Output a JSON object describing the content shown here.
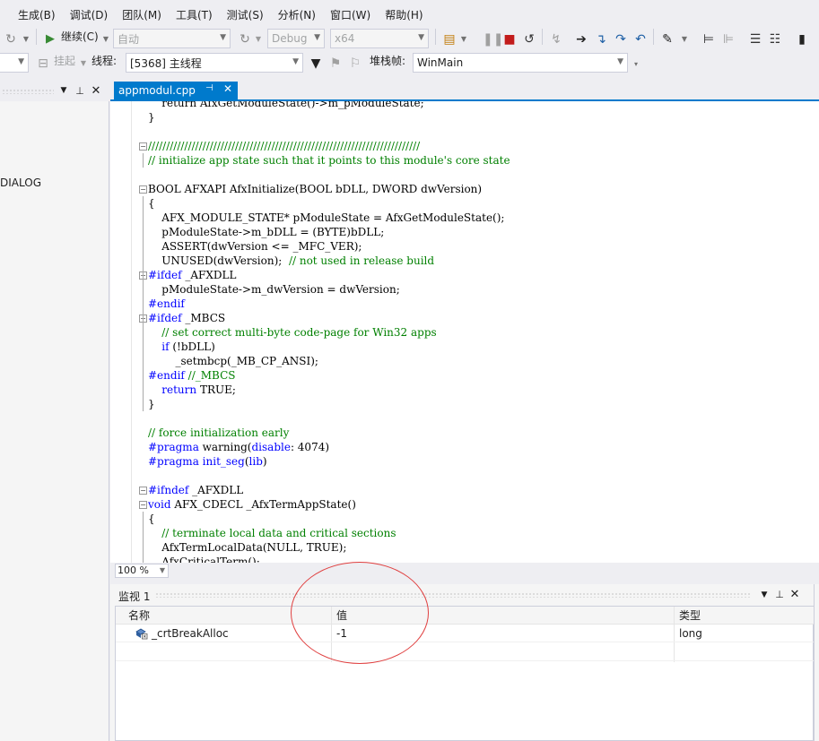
{
  "menu": [
    "生成(B)",
    "调试(D)",
    "团队(M)",
    "工具(T)",
    "测试(S)",
    "分析(N)",
    "窗口(W)",
    "帮助(H)"
  ],
  "toolbar": {
    "continue_label": "继续(C)",
    "config_value": "自动",
    "build_config": "Debug",
    "platform": "x64"
  },
  "debug_location": {
    "suspend_label": "挂起",
    "thread_label": "线程:",
    "thread_value": "[5368] 主线程",
    "stack_label": "堆栈帧:",
    "stack_value": "WinMain"
  },
  "left_panel": {
    "truncated_item": "DIALOG"
  },
  "editor_tab": {
    "filename": "appmodul.cpp"
  },
  "code_lines": [
    {
      "segments": [
        {
          "t": "    ",
          "c": ""
        },
        {
          "t": "return AfxGetModuleState()->m_pModuleState;",
          "c": ""
        }
      ]
    },
    {
      "segments": [
        {
          "t": "}",
          "c": ""
        }
      ]
    },
    {
      "segments": [
        {
          "t": "",
          "c": ""
        }
      ]
    },
    {
      "segments": [
        {
          "t": "///////////////////////////////////////////////////////////////////////////",
          "c": "cm"
        }
      ]
    },
    {
      "segments": [
        {
          "t": "// initialize app state such that it points to this module's core state",
          "c": "cm"
        }
      ]
    },
    {
      "segments": [
        {
          "t": "",
          "c": ""
        }
      ]
    },
    {
      "segments": [
        {
          "t": "BOOL AFXAPI AfxInitialize(BOOL bDLL, DWORD dwVersion)",
          "c": ""
        }
      ]
    },
    {
      "segments": [
        {
          "t": "{",
          "c": ""
        }
      ]
    },
    {
      "segments": [
        {
          "t": "    AFX_MODULE_STATE* pModuleState = AfxGetModuleState();",
          "c": ""
        }
      ]
    },
    {
      "segments": [
        {
          "t": "    pModuleState->m_bDLL = (BYTE)bDLL;",
          "c": ""
        }
      ]
    },
    {
      "segments": [
        {
          "t": "    ASSERT(dwVersion <= _MFC_VER);",
          "c": ""
        }
      ]
    },
    {
      "segments": [
        {
          "t": "    UNUSED(dwVersion);  ",
          "c": ""
        },
        {
          "t": "// not used in release build",
          "c": "cm"
        }
      ]
    },
    {
      "segments": [
        {
          "t": "#ifdef",
          "c": "pp"
        },
        {
          "t": " _AFXDLL",
          "c": ""
        }
      ]
    },
    {
      "segments": [
        {
          "t": "    pModuleState->m_dwVersion = dwVersion;",
          "c": ""
        }
      ]
    },
    {
      "segments": [
        {
          "t": "#endif",
          "c": "pp"
        }
      ]
    },
    {
      "segments": [
        {
          "t": "#ifdef",
          "c": "pp"
        },
        {
          "t": " _MBCS",
          "c": ""
        }
      ]
    },
    {
      "segments": [
        {
          "t": "    // set correct multi-byte code-page for Win32 apps",
          "c": "cm"
        }
      ]
    },
    {
      "segments": [
        {
          "t": "    ",
          "c": ""
        },
        {
          "t": "if",
          "c": "kw"
        },
        {
          "t": " (!bDLL)",
          "c": ""
        }
      ]
    },
    {
      "segments": [
        {
          "t": "        _setmbcp(_MB_CP_ANSI);",
          "c": ""
        }
      ]
    },
    {
      "segments": [
        {
          "t": "#endif",
          "c": "pp"
        },
        {
          "t": " //_MBCS",
          "c": "cm"
        }
      ]
    },
    {
      "segments": [
        {
          "t": "    ",
          "c": ""
        },
        {
          "t": "return",
          "c": "kw"
        },
        {
          "t": " TRUE;",
          "c": ""
        }
      ]
    },
    {
      "segments": [
        {
          "t": "}",
          "c": ""
        }
      ]
    },
    {
      "segments": [
        {
          "t": "",
          "c": ""
        }
      ]
    },
    {
      "segments": [
        {
          "t": "// force initialization early",
          "c": "cm"
        }
      ]
    },
    {
      "segments": [
        {
          "t": "#pragma",
          "c": "pp"
        },
        {
          "t": " warning(",
          "c": ""
        },
        {
          "t": "disable",
          "c": "kw"
        },
        {
          "t": ": 4074)",
          "c": ""
        }
      ]
    },
    {
      "segments": [
        {
          "t": "#pragma",
          "c": "pp"
        },
        {
          "t": " ",
          "c": ""
        },
        {
          "t": "init_seg",
          "c": "kw"
        },
        {
          "t": "(",
          "c": ""
        },
        {
          "t": "lib",
          "c": "kw"
        },
        {
          "t": ")",
          "c": ""
        }
      ]
    },
    {
      "segments": [
        {
          "t": "",
          "c": ""
        }
      ]
    },
    {
      "segments": [
        {
          "t": "#ifndef",
          "c": "pp"
        },
        {
          "t": " _AFXDLL",
          "c": ""
        }
      ]
    },
    {
      "segments": [
        {
          "t": "void",
          "c": "kw"
        },
        {
          "t": " AFX_CDECL _AfxTermAppState()",
          "c": ""
        }
      ]
    },
    {
      "segments": [
        {
          "t": "{",
          "c": ""
        }
      ]
    },
    {
      "segments": [
        {
          "t": "    // terminate local data and critical sections",
          "c": "cm"
        }
      ]
    },
    {
      "segments": [
        {
          "t": "    AfxTermLocalData(NULL, TRUE);",
          "c": ""
        }
      ]
    },
    {
      "segments": [
        {
          "t": "    AfxCriticalTerm();",
          "c": ""
        }
      ]
    }
  ],
  "zoom": {
    "value": "100 %"
  },
  "watch": {
    "title": "监视 1",
    "columns": {
      "name": "名称",
      "value": "值",
      "type": "类型"
    },
    "rows": [
      {
        "name": "_crtBreakAlloc",
        "value": "-1",
        "type": "long"
      }
    ]
  },
  "colors": {
    "accent": "#007acc",
    "comment": "#008000",
    "keyword": "#0000ff",
    "annotation": "#e04040"
  }
}
